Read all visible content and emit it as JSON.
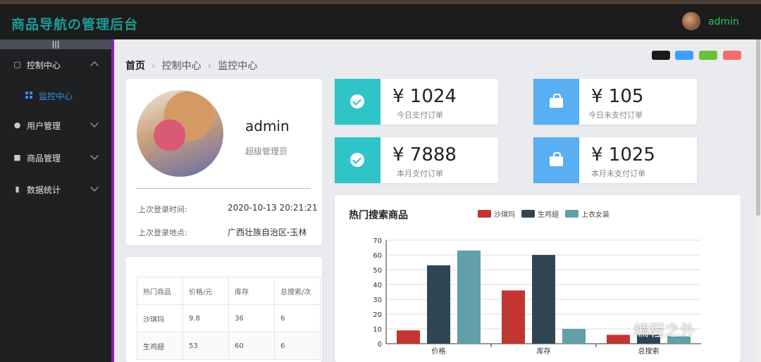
{
  "app": {
    "title": "商品导航の管理后台"
  },
  "header": {
    "username": "admin"
  },
  "sidebar": {
    "collapse_label": "|||",
    "items": [
      {
        "label": "控制中心",
        "icon": "monitor-icon",
        "expanded": true
      },
      {
        "label": "用户管理",
        "icon": "users-icon",
        "expanded": false
      },
      {
        "label": "商品管理",
        "icon": "bag-icon",
        "expanded": false
      },
      {
        "label": "数据统计",
        "icon": "bar-chart-icon",
        "expanded": false
      }
    ],
    "sub_items": [
      {
        "label": "监控中心",
        "icon": "grid-icon",
        "active": true
      }
    ]
  },
  "breadcrumb": {
    "home": "首页",
    "level1": "控制中心",
    "level2": "监控中心"
  },
  "theme_colors": [
    "#1b1b1b",
    "#409eff",
    "#67c23a",
    "#f56c6c"
  ],
  "profile": {
    "name": "admin",
    "role": "超级管理员",
    "last_login_time_label": "上次登录时间:",
    "last_login_time": "2020-10-13 20:21:21",
    "last_login_place_label": "上次登录地点:",
    "last_login_place": "广西壮族自治区-玉林"
  },
  "stats": [
    {
      "value": "¥ 1024",
      "label": "今日支付订单",
      "color": "#2ec4c8",
      "icon": "check-circle-icon"
    },
    {
      "value": "¥ 105",
      "label": "今日未支付订单",
      "color": "#5aaef2",
      "icon": "shopping-bag-icon"
    },
    {
      "value": "¥ 7888",
      "label": "本月支付订单",
      "color": "#2ec4c8",
      "icon": "check-circle-icon"
    },
    {
      "value": "¥ 1025",
      "label": "本月未支付订单",
      "color": "#5aaef2",
      "icon": "shopping-bag-icon"
    }
  ],
  "table": {
    "headers": [
      "热门商品",
      "价格/元",
      "库存",
      "总搜索/次"
    ],
    "rows": [
      [
        "沙琪玛",
        "9.8",
        "36",
        "6"
      ],
      [
        "生鸡翅",
        "53",
        "60",
        "6"
      ]
    ]
  },
  "chart_data": {
    "type": "bar",
    "title": "热门搜索商品",
    "categories": [
      "价格",
      "库存",
      "总搜索"
    ],
    "series": [
      {
        "name": "沙琪玛",
        "values": [
          9,
          36,
          6
        ],
        "color": "#c23531"
      },
      {
        "name": "生鸡翅",
        "values": [
          53,
          60,
          6
        ],
        "color": "#2f4554"
      },
      {
        "name": "上衣女装",
        "values": [
          63,
          10,
          5
        ],
        "color": "#61a0a8"
      }
    ],
    "ylim": [
      0,
      70
    ],
    "yticks": [
      "0",
      "10",
      "20",
      "30",
      "40",
      "50",
      "60",
      "70"
    ],
    "grid": true,
    "legend": "top"
  },
  "watermark": "编程之外"
}
